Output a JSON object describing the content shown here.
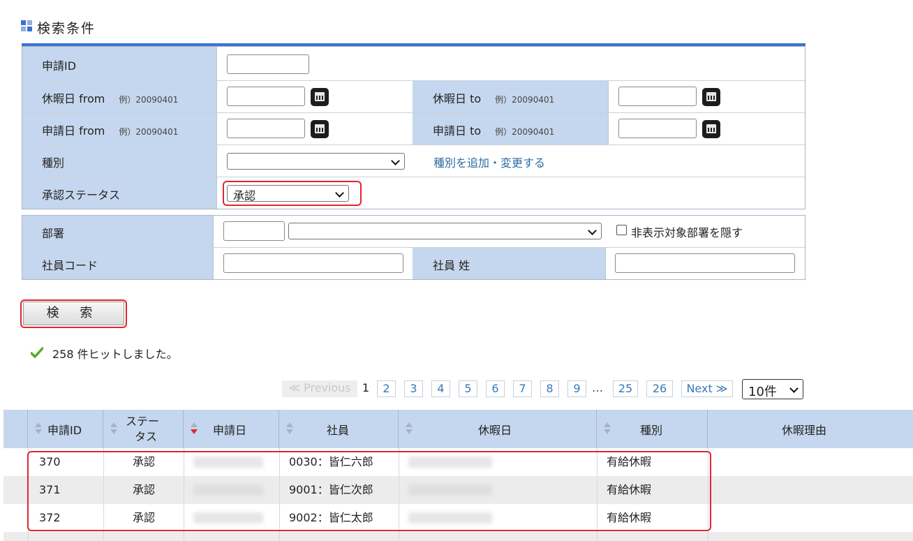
{
  "section": {
    "title": "検索条件",
    "icon": "grid-icon"
  },
  "form": {
    "request_id_label": "申請ID",
    "leave_from_label": "休暇日 from",
    "leave_to_label": "休暇日 to",
    "apply_from_label": "申請日 from",
    "apply_to_label": "申請日 to",
    "example_text": "例）20090401",
    "type_label": "種別",
    "type_value": "",
    "type_link": "種別を追加・変更する",
    "status_label": "承認ステータス",
    "status_value": "承認",
    "dept_label": "部署",
    "dept_value": "",
    "hide_dept_label": "非表示対象部署を隠す",
    "emp_code_label": "社員コード",
    "emp_name_label": "社員 姓"
  },
  "search_button": "検 索",
  "result_message": "258 件ヒットしました。",
  "pager": {
    "previous": "≪ Previous",
    "current": "1",
    "pages": [
      "2",
      "3",
      "4",
      "5",
      "6",
      "7",
      "8",
      "9"
    ],
    "ellipsis": "…",
    "last_pages": [
      "25",
      "26"
    ],
    "next": "Next ≫",
    "per_page": "10件"
  },
  "table": {
    "headers": {
      "id": "申請ID",
      "status_1": "ステー",
      "status_2": "タス",
      "apply_date": "申請日",
      "employee": "社員",
      "leave_date": "休暇日",
      "type": "種別",
      "reason": "休暇理由"
    },
    "rows": [
      {
        "id": "370",
        "status": "承認",
        "employee": "0030：皆仁六郎",
        "type": "有給休暇"
      },
      {
        "id": "371",
        "status": "承認",
        "employee": "9001：皆仁次郎",
        "type": "有給休暇"
      },
      {
        "id": "372",
        "status": "承認",
        "employee": "9002：皆仁太郎",
        "type": "有給休暇"
      }
    ]
  }
}
